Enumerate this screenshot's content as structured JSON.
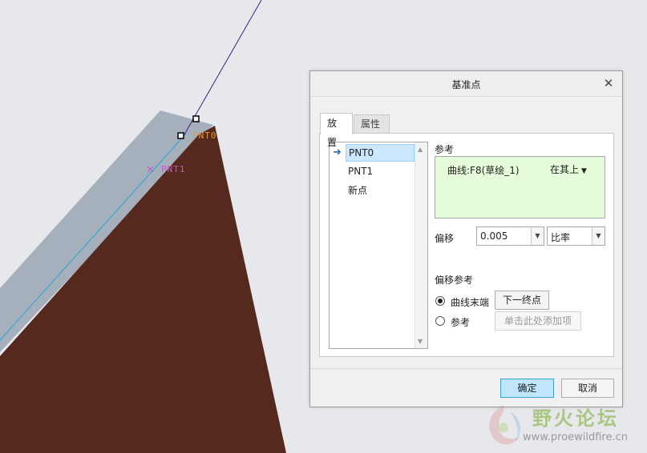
{
  "viewport": {
    "point_labels": [
      "PNT0",
      "PNT1"
    ],
    "colors": {
      "background": "#e6e8ec",
      "face_top": "#a6b0bc",
      "face_front": "#56291f",
      "curve": "#1fa7d6",
      "leader": "#3d1f8a",
      "pnt0": "#e59a3a",
      "pnt1": "#c855c8"
    }
  },
  "dialog": {
    "title": "基准点",
    "close_icon": "close-icon",
    "tabs": [
      {
        "label": "放置",
        "active": true
      },
      {
        "label": "属性",
        "active": false
      }
    ],
    "points": [
      "PNT0",
      "PNT1",
      "新点"
    ],
    "selected_point": "PNT0",
    "references": {
      "label": "参考",
      "curve_text": "曲线:F8(草绘_1)",
      "constraint": "在其上"
    },
    "offset": {
      "label": "偏移",
      "value": "0.005",
      "type": "比率"
    },
    "offset_ref": {
      "label": "偏移参考",
      "option_curve_end": "曲线末端",
      "next_endpoint_button": "下一终点",
      "option_reference": "参考",
      "add_item_placeholder": "单击此处添加项",
      "selected": "曲线末端"
    },
    "ok_button": "确定",
    "cancel_button": "取消"
  },
  "watermark": {
    "title": "野火论坛",
    "url": "www.proewildfire.cn"
  }
}
